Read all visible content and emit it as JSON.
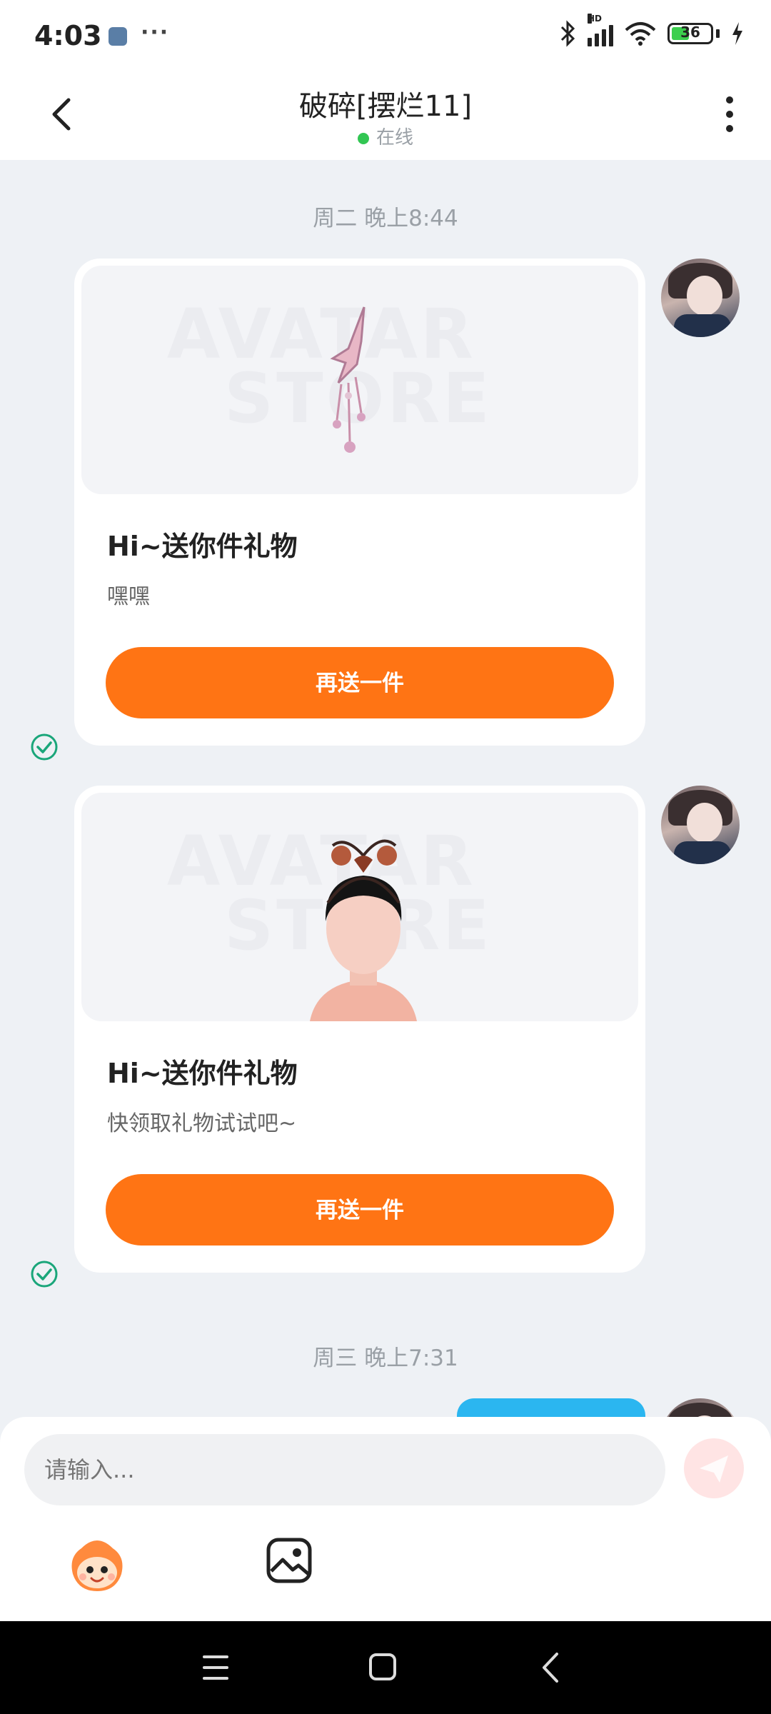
{
  "status_bar": {
    "time": "4:03",
    "network_label": "HD",
    "battery": "36"
  },
  "header": {
    "title": "破碎[摆烂11]",
    "status": "在线"
  },
  "messages": [
    {
      "timestamp": "周二 晚上8:44",
      "card": {
        "title": "Hi~送你件礼物",
        "subtitle": "嘿嘿",
        "button": "再送一件",
        "watermark_line1": "AVATAR",
        "watermark_line2": "STORE"
      }
    },
    {
      "card": {
        "title": "Hi~送你件礼物",
        "subtitle": "快领取礼物试试吧~",
        "button": "再送一件",
        "watermark_line1": "AVATAR",
        "watermark_line2": "STORE"
      }
    },
    {
      "timestamp": "周三 晚上7:31"
    }
  ],
  "input": {
    "placeholder": "请输入..."
  },
  "colors": {
    "accent_orange": "#ff7414",
    "online_green": "#32c653",
    "check_green": "#1aa67a",
    "bubble_blue": "#2bb6f0"
  }
}
